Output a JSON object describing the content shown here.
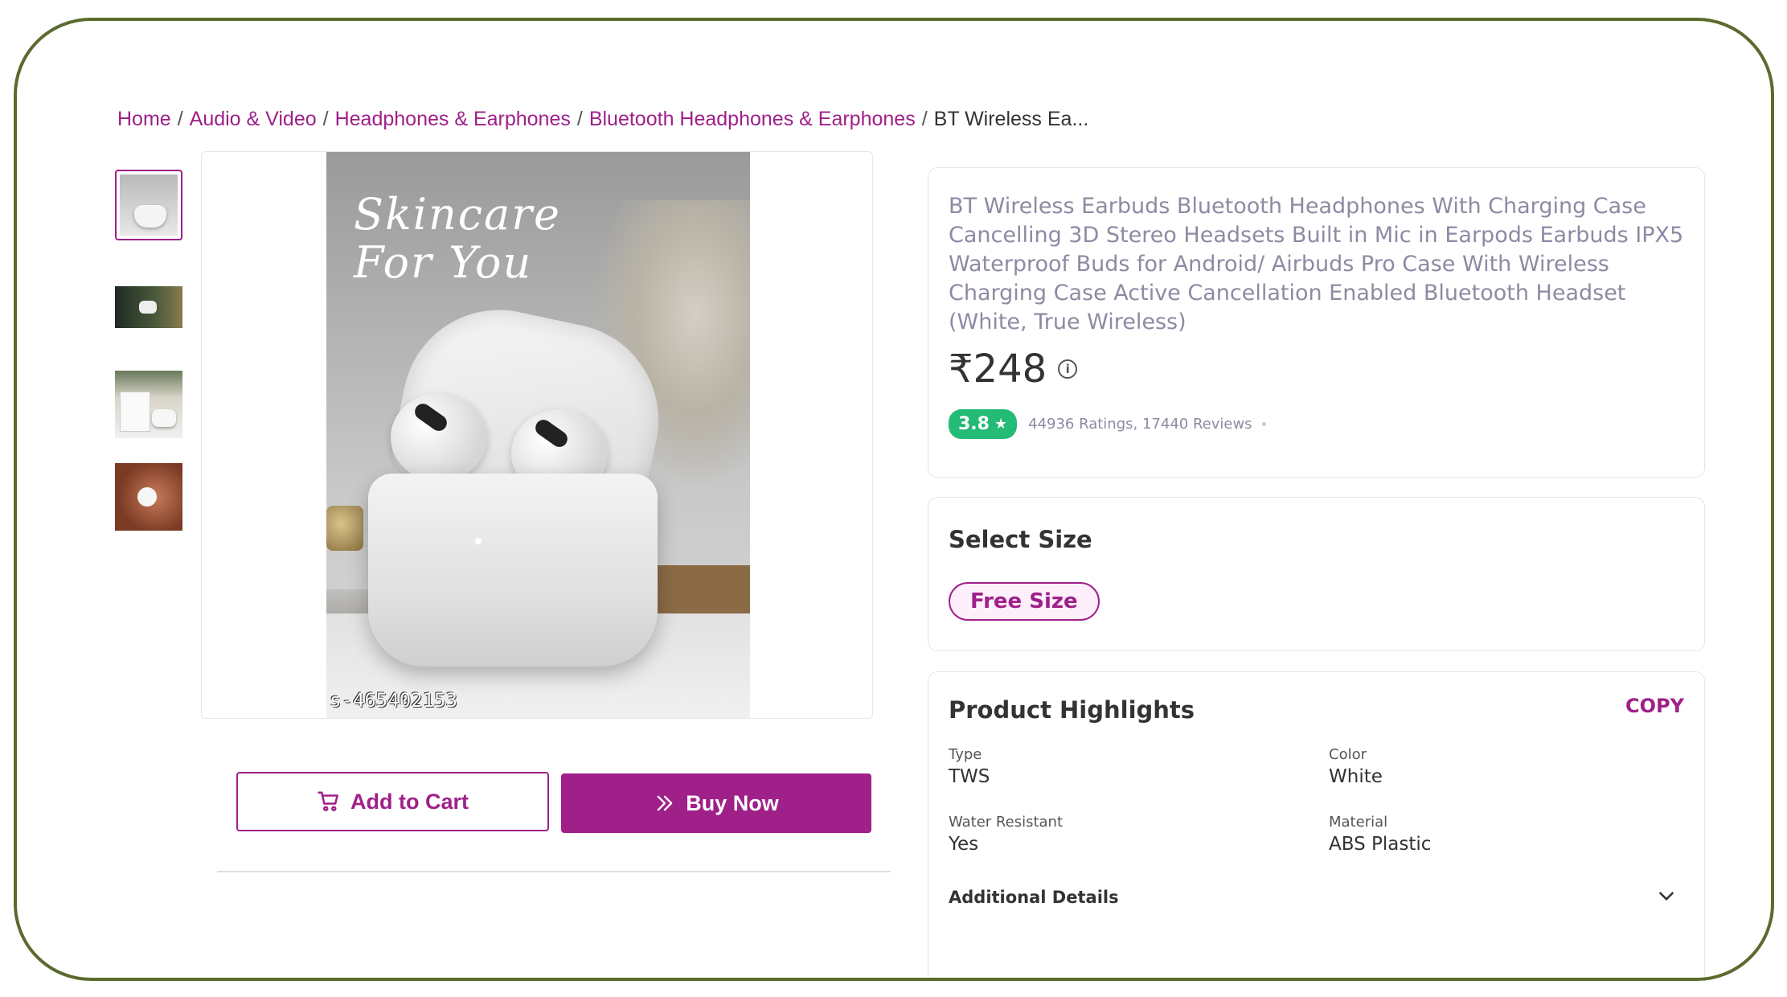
{
  "breadcrumb": {
    "items": [
      "Home",
      "Audio & Video",
      "Headphones & Earphones",
      "Bluetooth Headphones & Earphones"
    ],
    "current": "BT Wireless Ea...",
    "separator": "/"
  },
  "gallery": {
    "overlay_text_line1": "Skincare",
    "overlay_text_line2": "For You",
    "watermark": "s-465402153"
  },
  "actions": {
    "add_to_cart": "Add to Cart",
    "buy_now": "Buy Now"
  },
  "product": {
    "title": "BT Wireless Earbuds Bluetooth Headphones With Charging Case Cancelling 3D Stereo Headsets Built in Mic in Earpods Earbuds IPX5 Waterproof Buds for Android/ Airbuds Pro Case With Wireless Charging Case Active Cancellation Enabled Bluetooth Headset (White, True Wireless)",
    "price": "₹248",
    "info_icon": "i",
    "rating": "3.8",
    "reviews": "44936 Ratings, 17440 Reviews"
  },
  "size": {
    "title": "Select Size",
    "option": "Free Size"
  },
  "highlights": {
    "title": "Product Highlights",
    "copy": "COPY",
    "items": [
      {
        "label": "Type",
        "value": "TWS"
      },
      {
        "label": "Color",
        "value": "White"
      },
      {
        "label": "Water Resistant",
        "value": "Yes"
      },
      {
        "label": "Material",
        "value": "ABS Plastic"
      }
    ],
    "additional": "Additional Details"
  },
  "colors": {
    "accent": "#9f2089",
    "rating_green": "#23bb75",
    "frame_border": "#5b6a2e"
  }
}
